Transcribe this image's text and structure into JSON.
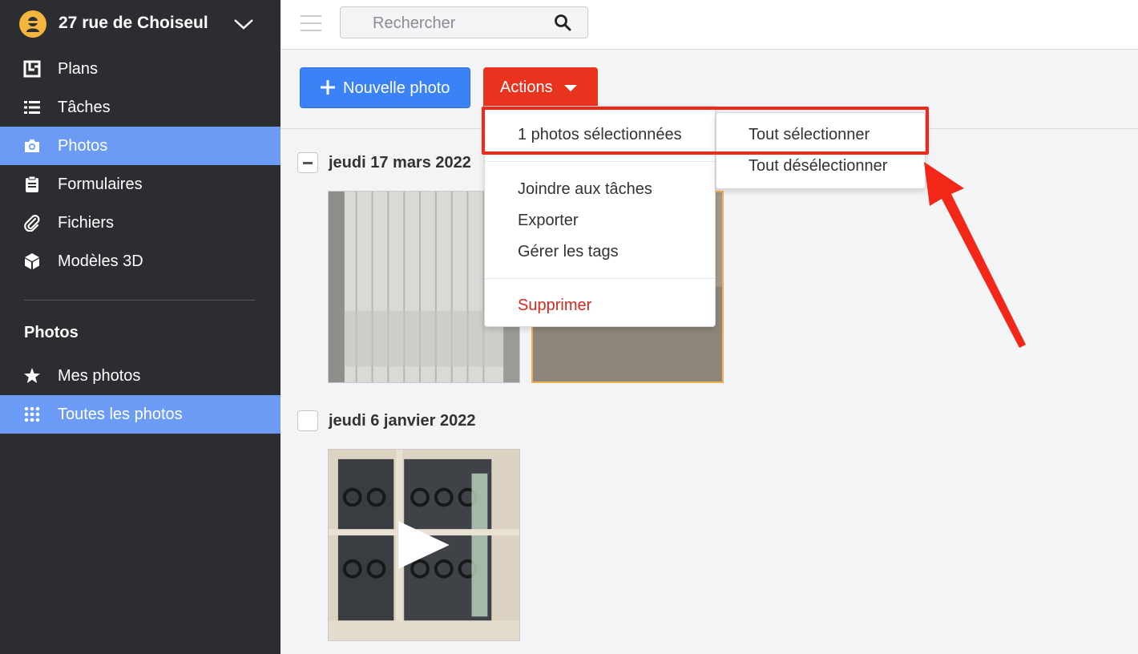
{
  "project": {
    "name": "27 rue de Choiseul"
  },
  "sidebar": {
    "items": [
      {
        "label": "Plans",
        "icon": "floorplan-icon",
        "active": false
      },
      {
        "label": "Tâches",
        "icon": "list-icon",
        "active": false
      },
      {
        "label": "Photos",
        "icon": "camera-icon",
        "active": true
      },
      {
        "label": "Formulaires",
        "icon": "clipboard-icon",
        "active": false
      },
      {
        "label": "Fichiers",
        "icon": "paperclip-icon",
        "active": false
      },
      {
        "label": "Modèles 3D",
        "icon": "cube-icon",
        "active": false
      }
    ],
    "section_title": "Photos",
    "sub_items": [
      {
        "label": "Mes photos",
        "icon": "star-icon",
        "active": false
      },
      {
        "label": "Toutes les photos",
        "icon": "grid-dots-icon",
        "active": true
      }
    ]
  },
  "search": {
    "placeholder": "Rechercher"
  },
  "toolbar": {
    "new_photo_label": "Nouvelle photo",
    "actions_label": "Actions"
  },
  "groups": [
    {
      "date": "jeudi 17 mars 2022",
      "check_state": "partial"
    },
    {
      "date": "jeudi 6 janvier 2022",
      "check_state": "unchecked"
    }
  ],
  "actions_menu": {
    "selection_label": "1 photos sélectionnées",
    "items": [
      "Joindre aux tâches",
      "Exporter",
      "Gérer les tags"
    ],
    "danger_item": "Supprimer"
  },
  "selection_submenu": {
    "items": [
      "Tout sélectionner",
      "Tout désélectionner"
    ]
  },
  "colors": {
    "sidebar_bg": "#2c2d30",
    "active_nav": "#6b9bf5",
    "primary_button": "#3b82f6",
    "actions_button": "#e8331f",
    "annotation_red": "#f22718",
    "selected_border": "#f3b24f"
  }
}
